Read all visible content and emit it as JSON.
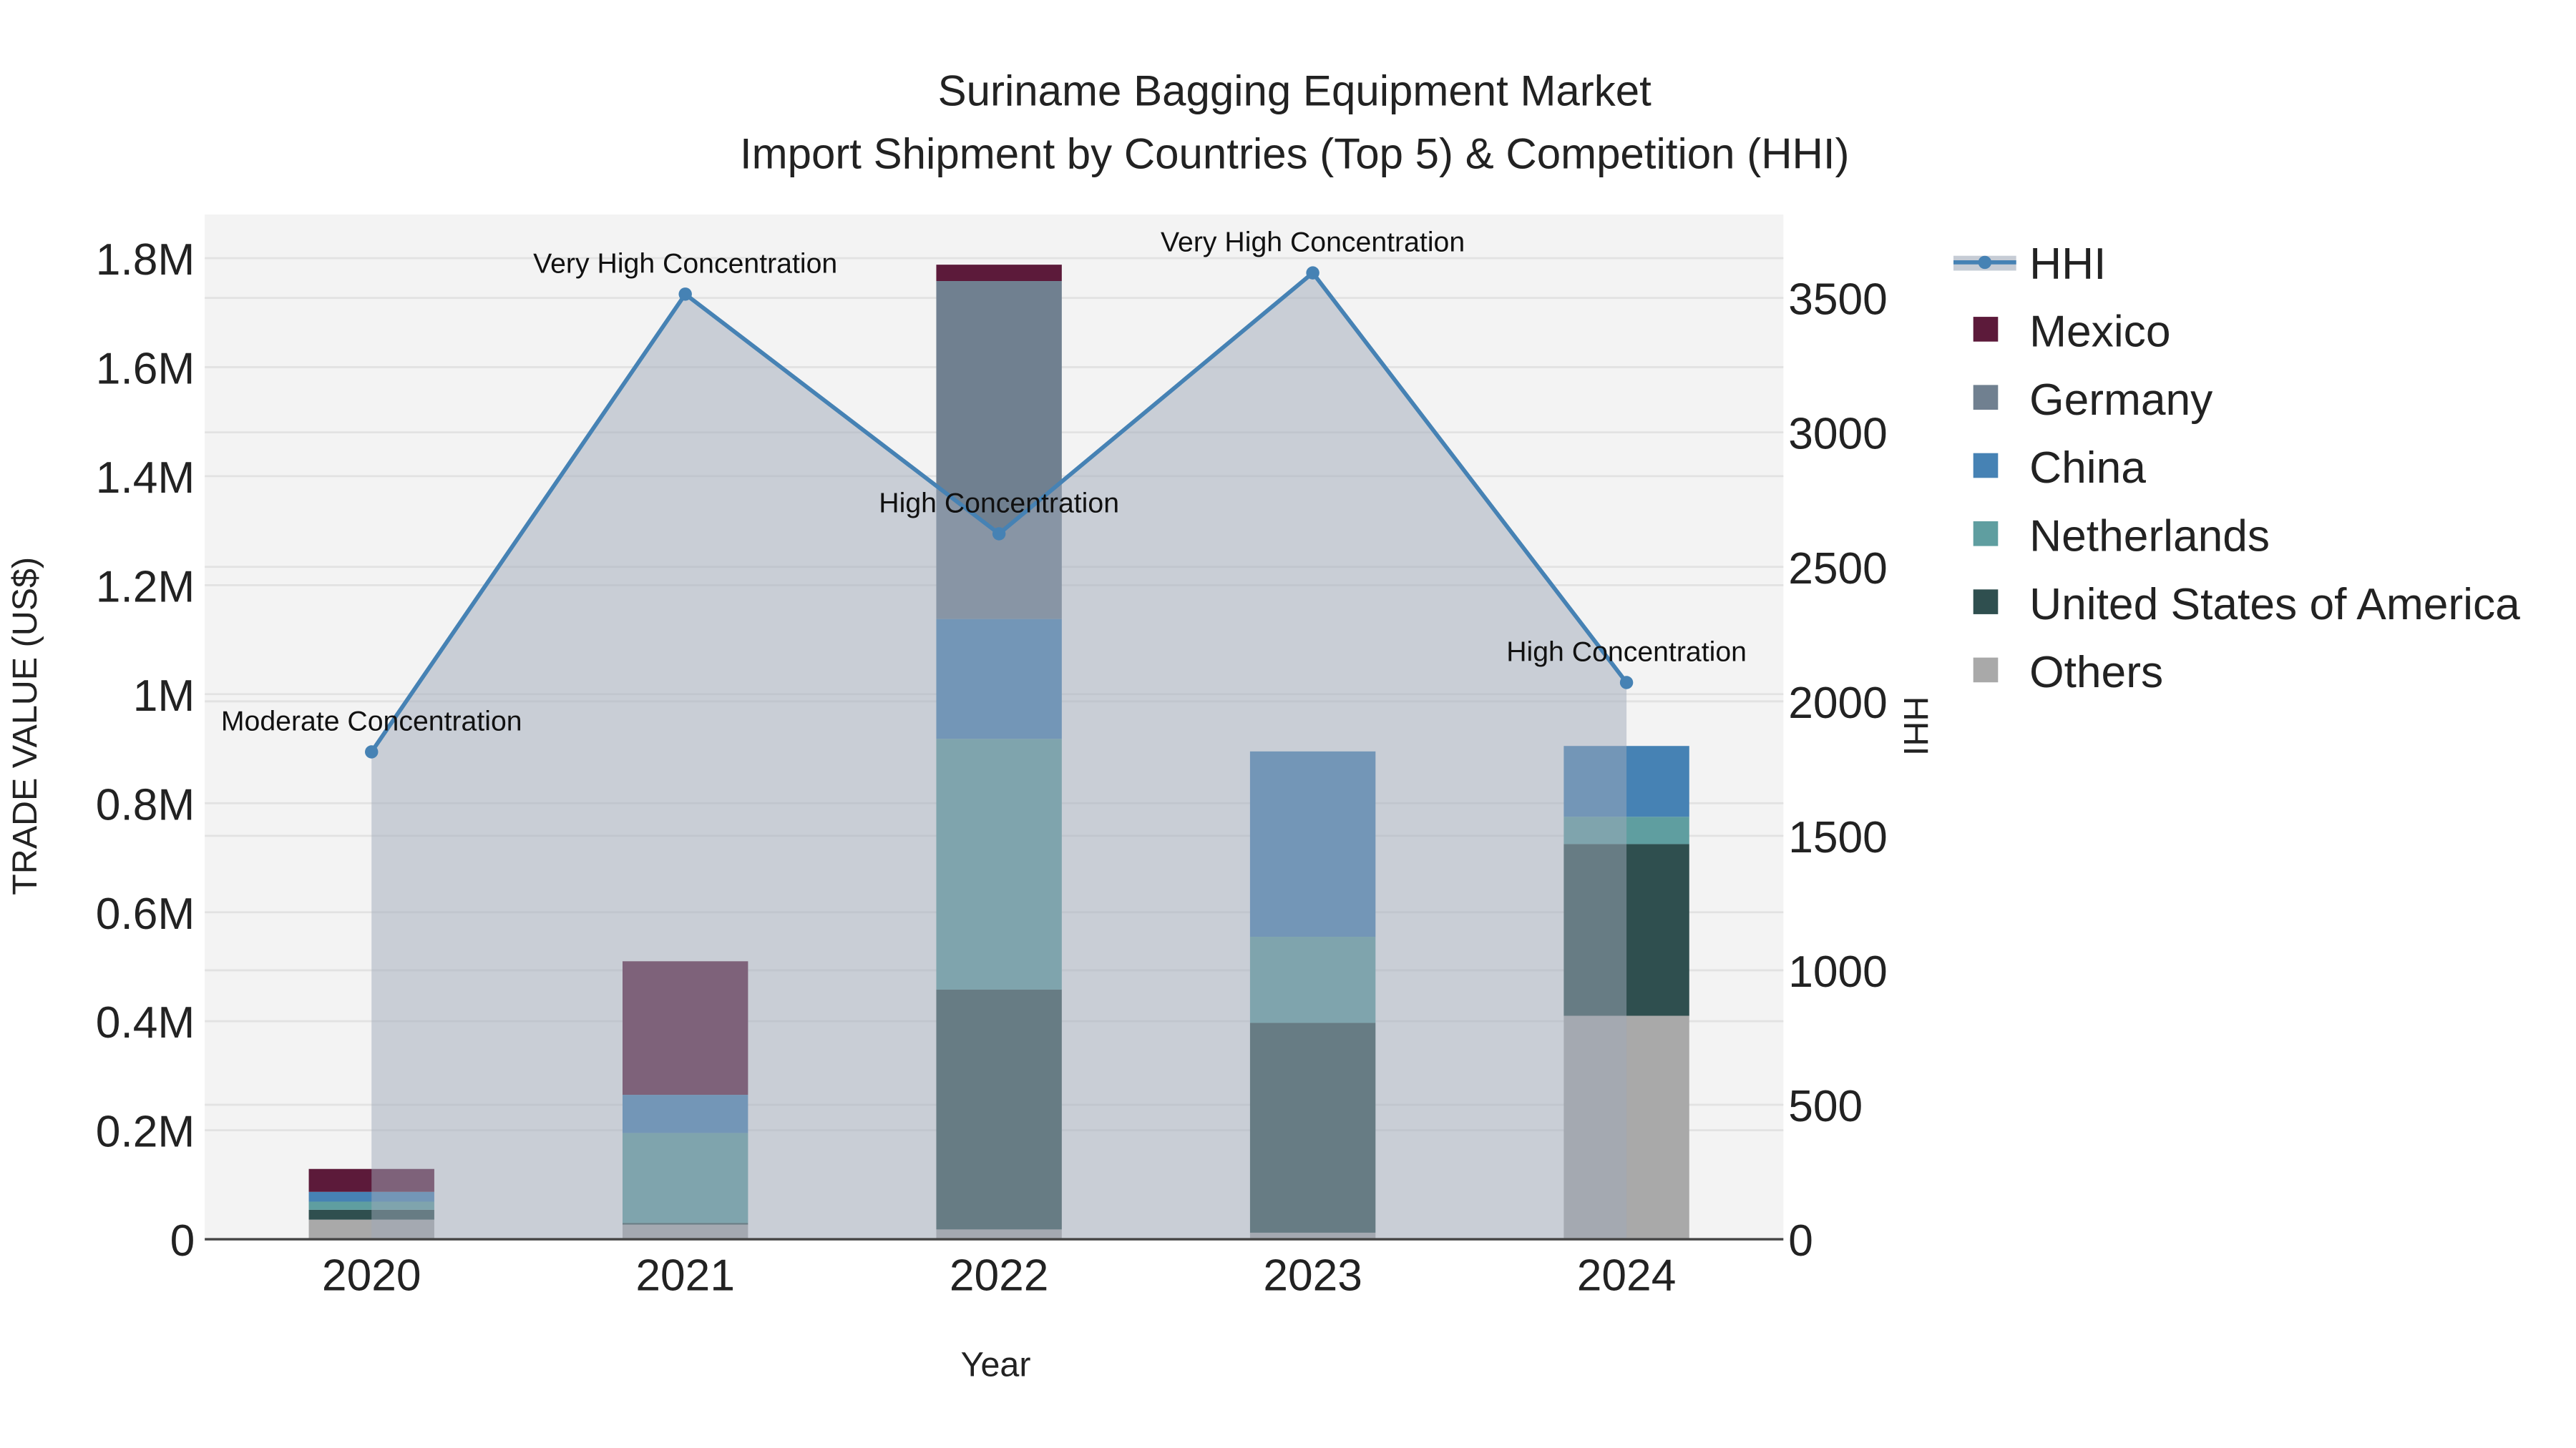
{
  "chart_data": {
    "type": "bar",
    "title": "Suriname Bagging Equipment Market",
    "subtitle": "Import Shipment by Countries (Top 5) & Competition (HHI)",
    "xlabel": "Year",
    "ylabel": "TRADE VALUE (US$)",
    "y2label": "HHI",
    "categories": [
      "2020",
      "2021",
      "2022",
      "2023",
      "2024"
    ],
    "ylim": [
      0,
      1880000
    ],
    "y2lim": [
      0,
      3810
    ],
    "yticks": [
      0,
      200000,
      400000,
      600000,
      800000,
      1000000,
      1200000,
      1400000,
      1600000,
      1800000
    ],
    "ytick_labels": [
      "0",
      "0.2M",
      "0.4M",
      "0.6M",
      "0.8M",
      "1M",
      "1.2M",
      "1.4M",
      "1.6M",
      "1.8M"
    ],
    "y2ticks": [
      0,
      500,
      1000,
      1500,
      2000,
      2500,
      3000,
      3500
    ],
    "y2tick_labels": [
      "0",
      "500",
      "1000",
      "1500",
      "2000",
      "2500",
      "3000",
      "3500"
    ],
    "series": [
      {
        "name": "Others",
        "color": "#a9a9a9",
        "values": [
          36000,
          27000,
          18000,
          12000,
          410000
        ]
      },
      {
        "name": "United States of America",
        "color": "#2f4f4f",
        "values": [
          18000,
          3000,
          440000,
          385000,
          315000
        ]
      },
      {
        "name": "Netherlands",
        "color": "#5f9ea0",
        "values": [
          15000,
          165000,
          460000,
          158000,
          50000
        ]
      },
      {
        "name": "China",
        "color": "#4682b4",
        "values": [
          18000,
          70000,
          220000,
          340000,
          130000
        ]
      },
      {
        "name": "Germany",
        "color": "#708090",
        "values": [
          0,
          0,
          620000,
          0,
          0
        ]
      },
      {
        "name": "Mexico",
        "color": "#5c1a3a",
        "values": [
          42000,
          245000,
          30000,
          0,
          0
        ]
      }
    ],
    "hhi": {
      "name": "HHI",
      "color": "#4682b4",
      "values": [
        1812,
        3514,
        2623,
        3593,
        2070
      ],
      "annotations": [
        "Moderate Concentration",
        "Very High Concentration",
        "High Concentration",
        "Very High Concentration",
        "High Concentration"
      ]
    },
    "legend": {
      "placement": "right",
      "order": [
        "HHI",
        "Mexico",
        "Germany",
        "China",
        "Netherlands",
        "United States of America",
        "Others"
      ]
    }
  }
}
